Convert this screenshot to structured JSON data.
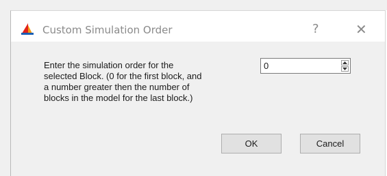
{
  "dialog": {
    "title": "Custom Simulation Order",
    "help_glyph": "?",
    "close_glyph": "✕",
    "message_lines": [
      "Enter the simulation order for the",
      "selected Block.  (0 for the first block, and",
      "a number greater then the number of",
      "blocks in the model for the last block.)"
    ],
    "order_value": "0",
    "ok_label": "OK",
    "cancel_label": "Cancel",
    "icons": {
      "app": "app-logo-icon",
      "help": "help-icon",
      "close": "close-icon",
      "spin_up": "spin-up-arrow-icon",
      "spin_down": "spin-down-arrow-icon"
    },
    "colors": {
      "logo_red": "#e2231a",
      "logo_orange": "#f39c12",
      "logo_blue": "#1a5fb4"
    }
  }
}
